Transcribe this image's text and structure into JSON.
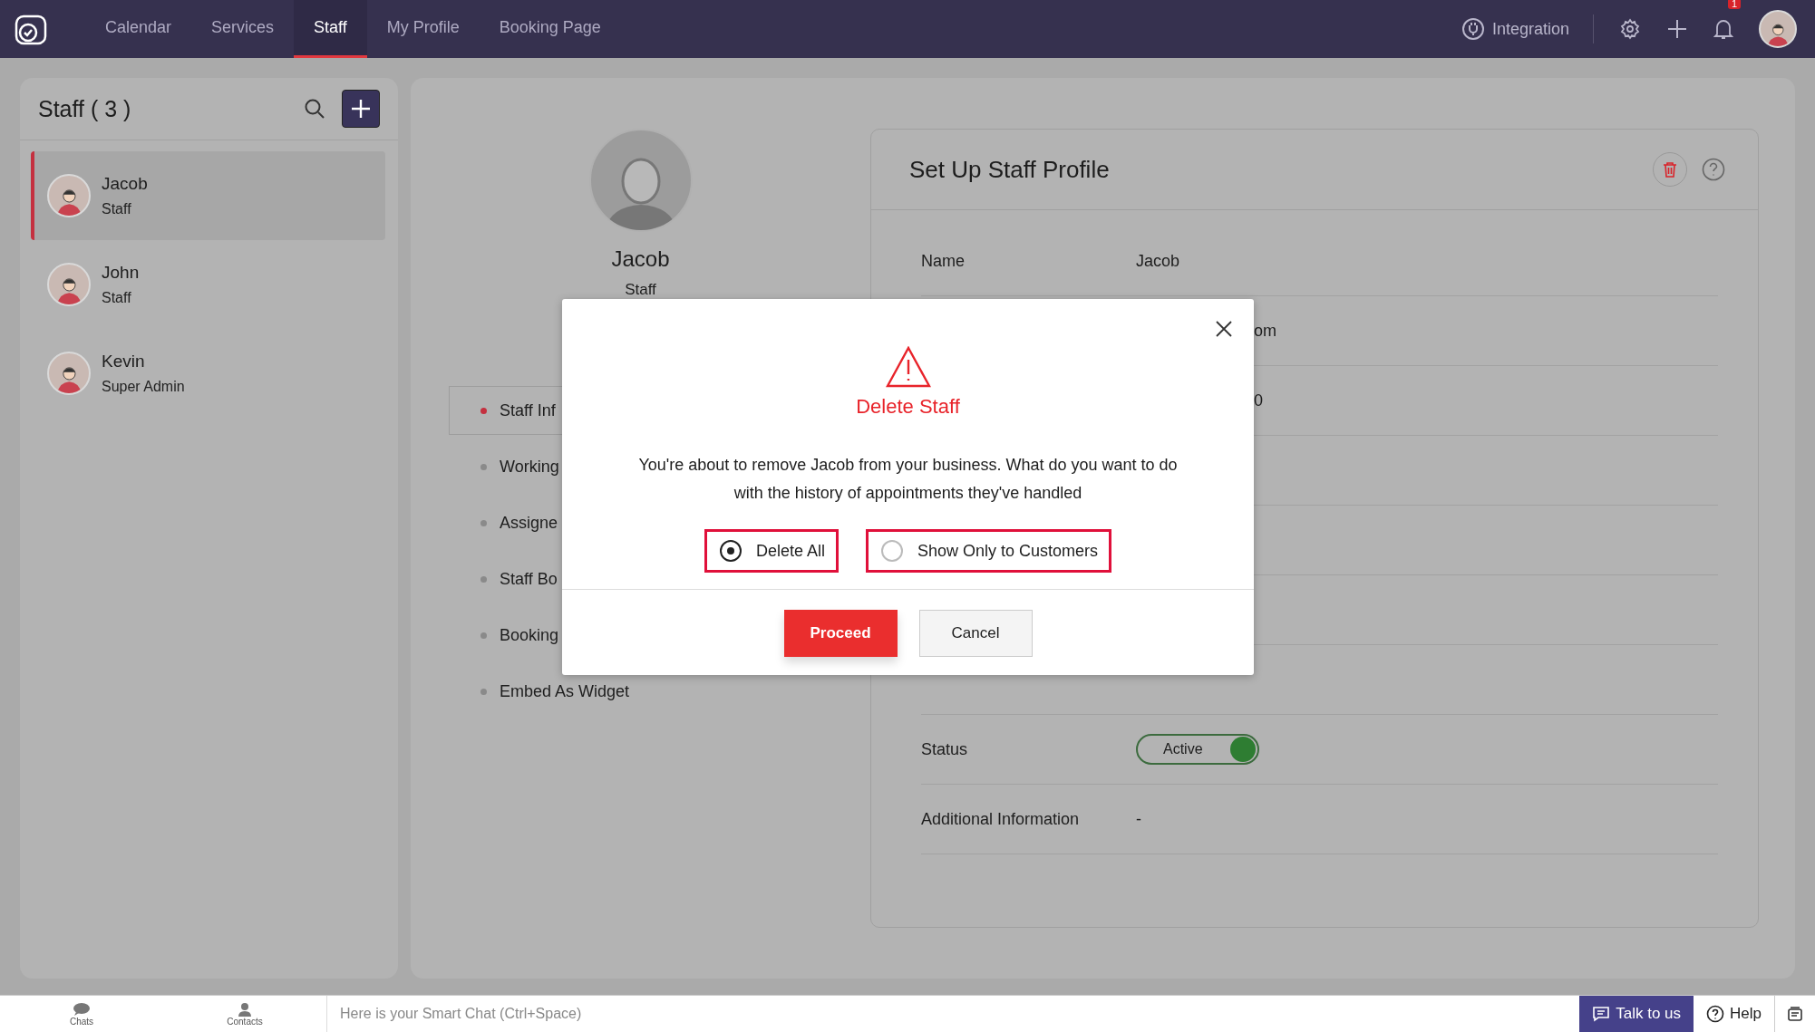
{
  "header": {
    "nav": [
      {
        "label": "Calendar",
        "selected": false
      },
      {
        "label": "Services",
        "selected": false
      },
      {
        "label": "Staff",
        "selected": true
      },
      {
        "label": "My Profile",
        "selected": false
      },
      {
        "label": "Booking Page",
        "selected": false
      }
    ],
    "integration": "Integration",
    "notification_count": "1"
  },
  "staff_panel": {
    "title": "Staff ( 3 )",
    "staff": [
      {
        "name": "Jacob",
        "role": "Staff",
        "selected": true
      },
      {
        "name": "John",
        "role": "Staff",
        "selected": false
      },
      {
        "name": "Kevin",
        "role": "Super Admin",
        "selected": false
      }
    ]
  },
  "profile": {
    "name": "Jacob",
    "role": "Staff",
    "menu": [
      {
        "label": "Staff Inf",
        "selected": true
      },
      {
        "label": "Working",
        "selected": false
      },
      {
        "label": "Assigne",
        "selected": false
      },
      {
        "label": "Staff Bo",
        "selected": false
      },
      {
        "label": "Booking",
        "selected": false
      },
      {
        "label": "Embed As Widget",
        "selected": false
      }
    ]
  },
  "details": {
    "title": "Set Up Staff Profile",
    "rows": [
      {
        "kind": "text",
        "label": "Name",
        "value": "Jacob"
      },
      {
        "kind": "fragment",
        "value": "om"
      },
      {
        "kind": "fragment",
        "value": "0"
      },
      {
        "kind": "blank"
      },
      {
        "kind": "blank"
      },
      {
        "kind": "blank"
      },
      {
        "kind": "blank"
      },
      {
        "kind": "status",
        "label": "Status",
        "value": "Active",
        "on": true
      },
      {
        "kind": "text",
        "label": "Additional Information",
        "value": "-"
      }
    ]
  },
  "modal": {
    "title": "Delete Staff",
    "message": "You're about to remove Jacob from your business. What do you want to do with the history of appointments they've handled",
    "options": [
      {
        "label": "Delete All",
        "selected": true
      },
      {
        "label": "Show Only to Customers",
        "selected": false
      }
    ],
    "proceed": "Proceed",
    "cancel": "Cancel"
  },
  "bottom_bar": {
    "chats": "Chats",
    "contacts": "Contacts",
    "placeholder": "Here is your Smart Chat (Ctrl+Space)",
    "talk": "Talk to us",
    "help": "Help"
  }
}
